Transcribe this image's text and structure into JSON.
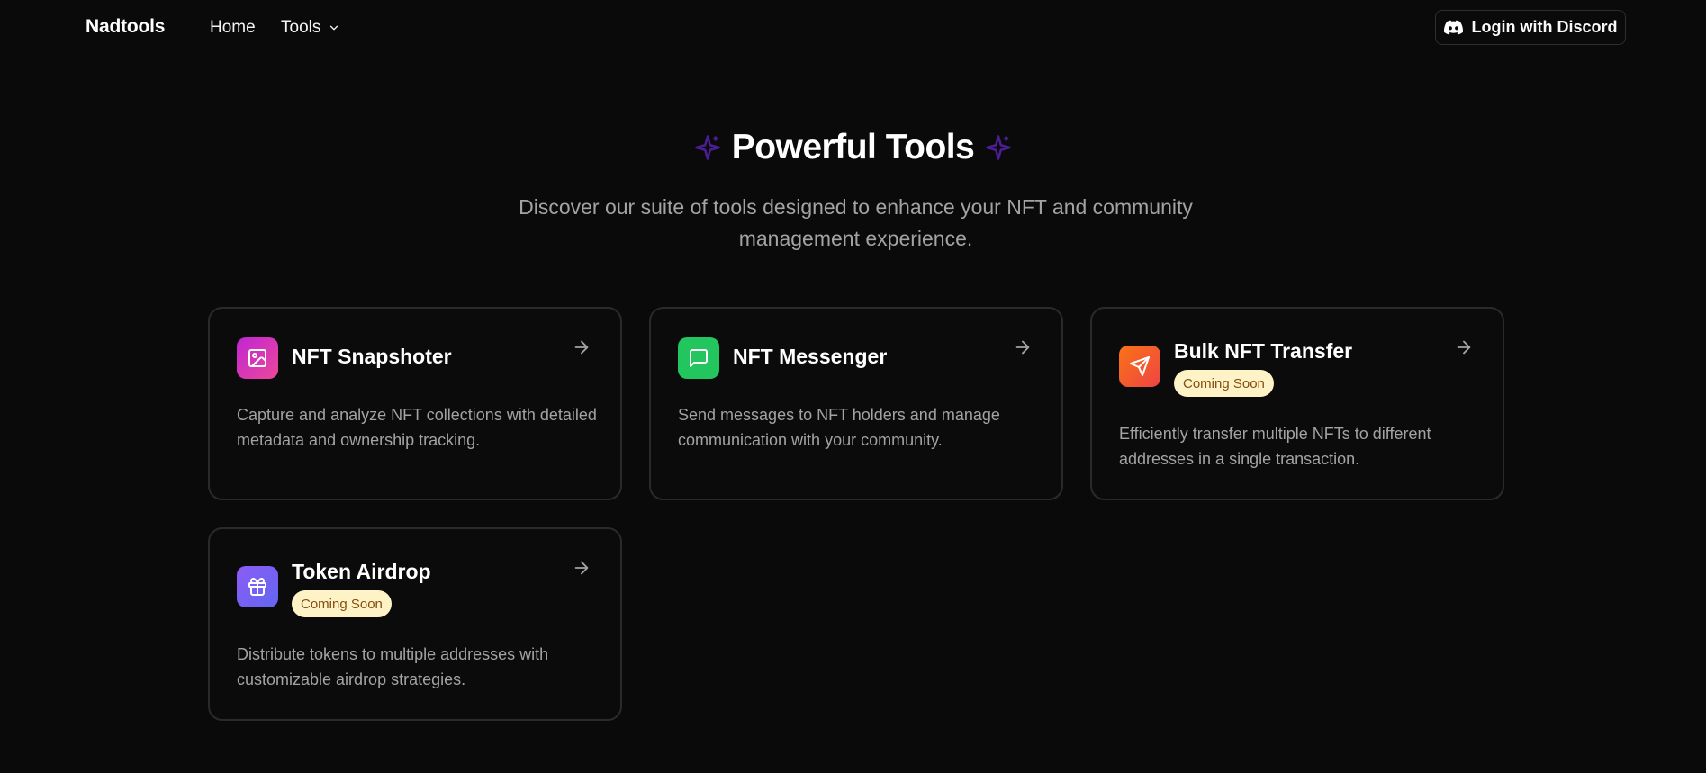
{
  "header": {
    "brand": "Nadtools",
    "nav": {
      "home": "Home",
      "tools": "Tools"
    },
    "login_label": "Login with Discord"
  },
  "hero": {
    "title": "Powerful Tools",
    "subtitle": "Discover our suite of tools designed to enhance your NFT and community management experience."
  },
  "cards": [
    {
      "title": "NFT Snapshoter",
      "icon": "image-icon",
      "accent": "#d946ef",
      "badge": "",
      "description": "Capture and analyze NFT collections with detailed metadata and ownership tracking."
    },
    {
      "title": "NFT Messenger",
      "icon": "message-square-icon",
      "accent": "#22c55e",
      "badge": "",
      "description": "Send messages to NFT holders and manage communication with your community."
    },
    {
      "title": "Bulk NFT Transfer",
      "icon": "send-icon",
      "accent": "#f97316",
      "badge": "Coming Soon",
      "description": "Efficiently transfer multiple NFTs to different addresses in a single transaction."
    },
    {
      "title": "Token Airdrop",
      "icon": "gift-icon",
      "accent": "#8b5cf6",
      "badge": "Coming Soon",
      "description": "Distribute tokens to multiple addresses with customizable airdrop strategies."
    }
  ],
  "colors": {
    "background": "#0a0a0a",
    "border": "#2a2a2a",
    "muted_text": "#a3a3a3",
    "sparkle": "#4c1d95",
    "badge_bg": "#fef3c7",
    "badge_text": "#854d0e"
  }
}
